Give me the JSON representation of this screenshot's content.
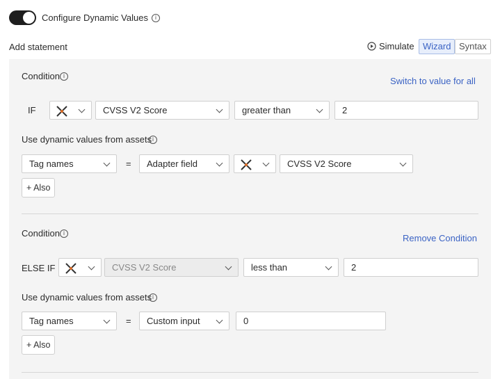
{
  "header": {
    "toggle_label": "Configure Dynamic Values",
    "add_statement": "Add statement",
    "simulate": "Simulate",
    "tabs": [
      "Wizard",
      "Syntax"
    ]
  },
  "conditions": [
    {
      "title": "Condition",
      "action_link": "Switch to value for all",
      "keyword": "IF",
      "field": "CVSS V2 Score",
      "operator": "greater than",
      "value": "2",
      "dynamic_title": "Use dynamic values from assets",
      "target": "Tag names",
      "equals": "=",
      "source": "Adapter field",
      "source_field": "CVSS V2 Score",
      "also": "+ Also"
    },
    {
      "title": "Condition",
      "action_link": "Remove Condition",
      "keyword": "ELSE IF",
      "field": "CVSS V2 Score",
      "operator": "less than",
      "value": "2",
      "dynamic_title": "Use dynamic values from assets",
      "target": "Tag names",
      "equals": "=",
      "source": "Custom input",
      "custom_value": "0",
      "also": "+ Also"
    }
  ],
  "colors": {
    "accent": "#3b63c4",
    "toggle_on": "#1e1e1e",
    "panel_bg": "#f4f4f4"
  },
  "icons": [
    "info-icon",
    "play-circle-icon",
    "adapter-x-icon",
    "chevron-down-icon"
  ]
}
